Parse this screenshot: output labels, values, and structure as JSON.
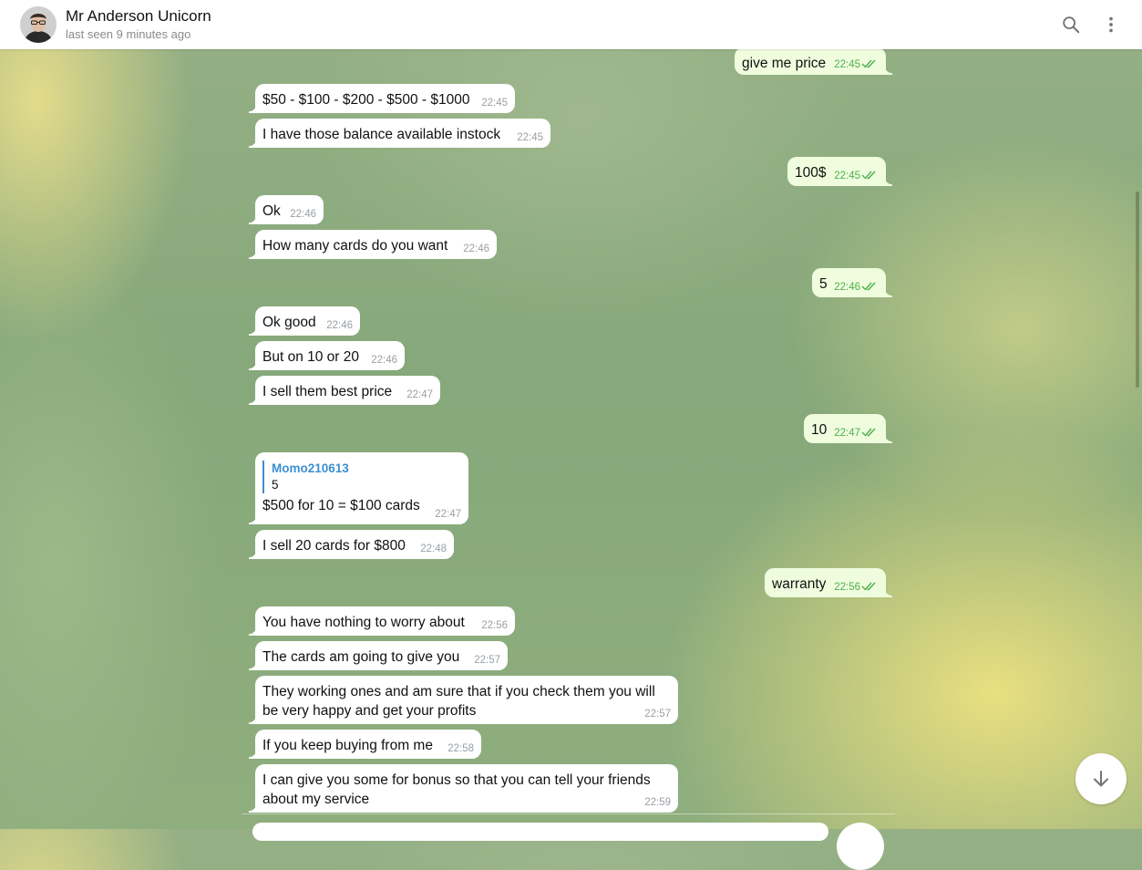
{
  "header": {
    "title": "Mr Anderson Unicorn",
    "status": "last seen 9 minutes ago"
  },
  "colors": {
    "outgoing_bubble": "#effdde",
    "incoming_bubble": "#ffffff",
    "outgoing_time": "#4fae4e",
    "reply_accent": "#3d8fd1"
  },
  "icons": {
    "search": "search-icon",
    "menu": "more-vertical-icon",
    "read_status": "double-check-icon",
    "scroll_down": "arrow-down-icon"
  },
  "messages": [
    {
      "direction": "out",
      "text": "give me price",
      "time": "22:45",
      "read": true
    },
    {
      "direction": "in",
      "text": "$50 - $100 - $200 - $500 - $1000",
      "time": "22:45"
    },
    {
      "direction": "in",
      "text": "I have those balance available instock",
      "time": "22:45"
    },
    {
      "direction": "out",
      "text": "100$",
      "time": "22:45",
      "read": true
    },
    {
      "direction": "in",
      "text": "Ok",
      "time": "22:46"
    },
    {
      "direction": "in",
      "text": "How many cards do you want",
      "time": "22:46"
    },
    {
      "direction": "out",
      "text": "5",
      "time": "22:46",
      "read": true
    },
    {
      "direction": "in",
      "text": "Ok good",
      "time": "22:46"
    },
    {
      "direction": "in",
      "text": "But on 10 or 20",
      "time": "22:46"
    },
    {
      "direction": "in",
      "text": "I sell them best price",
      "time": "22:47"
    },
    {
      "direction": "out",
      "text": "10",
      "time": "22:47",
      "read": true
    },
    {
      "direction": "in",
      "reply_to": {
        "name": "Momo210613",
        "text": "5"
      },
      "text": "$500 for 10 = $100 cards",
      "time": "22:47"
    },
    {
      "direction": "in",
      "text": "I sell 20 cards for $800",
      "time": "22:48"
    },
    {
      "direction": "out",
      "text": "warranty",
      "time": "22:56",
      "read": true
    },
    {
      "direction": "in",
      "text": "You have nothing to worry about",
      "time": "22:56"
    },
    {
      "direction": "in",
      "text": "The cards am going to give you",
      "time": "22:57"
    },
    {
      "direction": "in",
      "text": "They working ones and am sure that if you check them you will be very happy and get your profits",
      "time": "22:57"
    },
    {
      "direction": "in",
      "text": "If you keep buying from me",
      "time": "22:58"
    },
    {
      "direction": "in",
      "text": "I can give you some for bonus so that you can tell your friends about my service",
      "time": "22:59"
    }
  ]
}
